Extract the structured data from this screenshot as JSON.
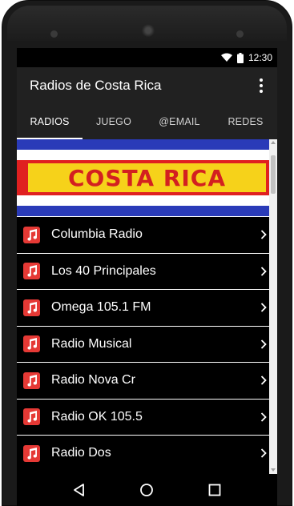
{
  "status_bar": {
    "time": "12:30",
    "icons": [
      "wifi-icon",
      "battery-icon"
    ]
  },
  "app_bar": {
    "title": "Radios de Costa Rica",
    "menu_icon": "more-vert-icon"
  },
  "tabs": [
    {
      "label": "RADIOS",
      "active": true
    },
    {
      "label": "JUEGO",
      "active": false
    },
    {
      "label": "@EMAIL",
      "active": false
    },
    {
      "label": "REDES",
      "active": false
    }
  ],
  "banner": {
    "text": "COSTA RICA",
    "colors": {
      "blue": "#2a3bb8",
      "white": "#ffffff",
      "red": "#e02020",
      "yellow": "#f6d21a"
    }
  },
  "stations": [
    {
      "label": "Columbia Radio",
      "icon": "music-note-icon"
    },
    {
      "label": "Los 40 Principales",
      "icon": "music-note-icon"
    },
    {
      "label": "Omega 105.1 FM",
      "icon": "music-note-icon"
    },
    {
      "label": "Radio Musical",
      "icon": "music-note-icon"
    },
    {
      "label": "Radio Nova Cr",
      "icon": "music-note-icon"
    },
    {
      "label": "Radio OK 105.5",
      "icon": "music-note-icon"
    },
    {
      "label": "Radio Dos",
      "icon": "music-note-icon"
    }
  ],
  "nav_bar": {
    "buttons": [
      "back-icon",
      "home-icon",
      "recents-icon"
    ]
  },
  "colors": {
    "app_bar": "#212121",
    "icon_red": "#e53935",
    "list_bg": "#000000"
  }
}
